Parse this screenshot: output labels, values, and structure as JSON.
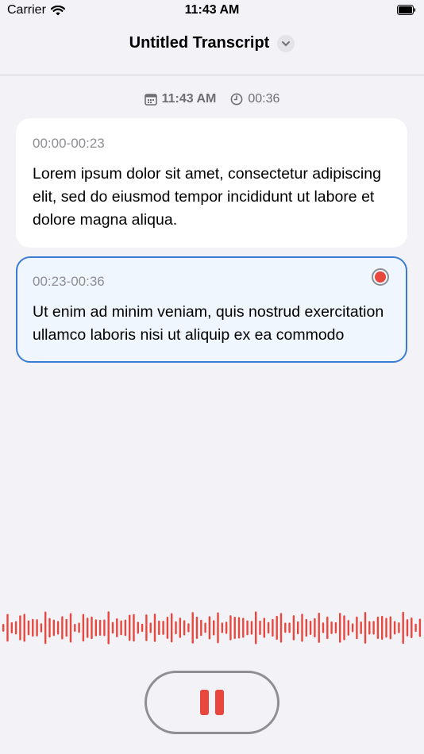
{
  "status_bar": {
    "carrier": "Carrier",
    "time": "11:43 AM"
  },
  "nav": {
    "title": "Untitled Transcript",
    "dropdown_icon": "chevron-down-icon"
  },
  "meta": {
    "start_time": "11:43 AM",
    "duration": "00:36",
    "start_icon": "calendar-icon",
    "duration_icon": "clock-icon"
  },
  "segments": [
    {
      "range": "00:00-00:23",
      "text": "Lorem ipsum dolor sit amet, consectetur adipiscing elit, sed do eiusmod tempor incididunt ut labore et dolore magna aliqua."
    },
    {
      "range": "00:23-00:36",
      "text": "Ut enim ad minim veniam, quis nostrud exercitation ullamco laboris nisi ut aliquip ex ea commodo",
      "recording": true
    }
  ],
  "colors": {
    "accent": "#3a7bd5",
    "record": "#e8473d",
    "background": "#f2f2f7"
  },
  "controls": {
    "pause_icon": "pause-icon"
  }
}
